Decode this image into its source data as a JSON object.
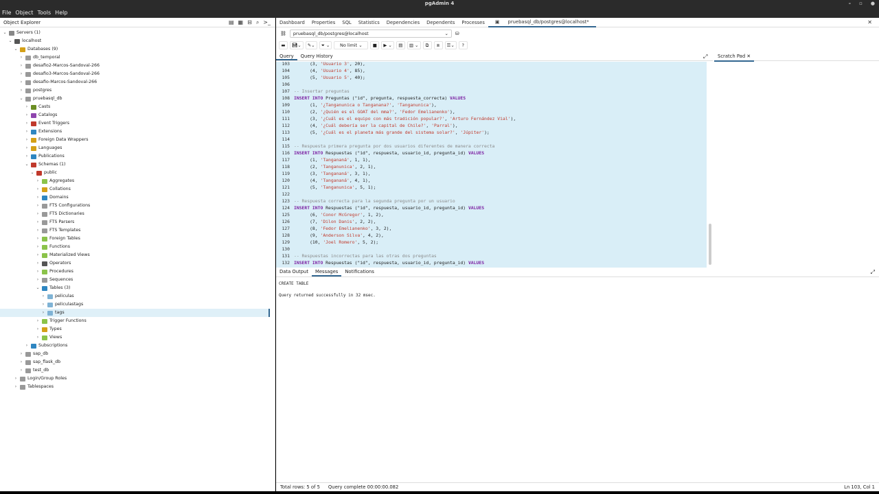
{
  "window": {
    "title": "pgAdmin 4"
  },
  "menu": [
    "File",
    "Object",
    "Tools",
    "Help"
  ],
  "explorer": {
    "title": "Object Explorer",
    "nodes": [
      {
        "label": "Servers (1)",
        "depth": 0,
        "chev": "v",
        "icon": "#888"
      },
      {
        "label": "localhost",
        "depth": 1,
        "chev": "v",
        "icon": "#555"
      },
      {
        "label": "Databases (9)",
        "depth": 2,
        "chev": "v",
        "icon": "#d4a017"
      },
      {
        "label": "db_temporal",
        "depth": 3,
        "chev": ">",
        "icon": "#999"
      },
      {
        "label": "desafio2-Marcos-Sandoval-266",
        "depth": 3,
        "chev": ">",
        "icon": "#999"
      },
      {
        "label": "desafio3-Marcos-Sandoval-266",
        "depth": 3,
        "chev": ">",
        "icon": "#999"
      },
      {
        "label": "desafio-Marcos-Sandoval-266",
        "depth": 3,
        "chev": ">",
        "icon": "#999"
      },
      {
        "label": "postgres",
        "depth": 3,
        "chev": ">",
        "icon": "#999"
      },
      {
        "label": "pruebasql_db",
        "depth": 3,
        "chev": "v",
        "icon": "#999"
      },
      {
        "label": "Casts",
        "depth": 4,
        "chev": ">",
        "icon": "#6b8e23"
      },
      {
        "label": "Catalogs",
        "depth": 4,
        "chev": ">",
        "icon": "#8e44ad"
      },
      {
        "label": "Event Triggers",
        "depth": 4,
        "chev": ">",
        "icon": "#c0392b"
      },
      {
        "label": "Extensions",
        "depth": 4,
        "chev": ">",
        "icon": "#2e86c1"
      },
      {
        "label": "Foreign Data Wrappers",
        "depth": 4,
        "chev": ">",
        "icon": "#d4a017"
      },
      {
        "label": "Languages",
        "depth": 4,
        "chev": ">",
        "icon": "#d4a017"
      },
      {
        "label": "Publications",
        "depth": 4,
        "chev": ">",
        "icon": "#2e86c1"
      },
      {
        "label": "Schemas (1)",
        "depth": 4,
        "chev": "v",
        "icon": "#c0392b"
      },
      {
        "label": "public",
        "depth": 5,
        "chev": "v",
        "icon": "#c0392b"
      },
      {
        "label": "Aggregates",
        "depth": 6,
        "chev": ">",
        "icon": "#8bc34a"
      },
      {
        "label": "Collations",
        "depth": 6,
        "chev": ">",
        "icon": "#d4a017"
      },
      {
        "label": "Domains",
        "depth": 6,
        "chev": ">",
        "icon": "#2e86c1"
      },
      {
        "label": "FTS Configurations",
        "depth": 6,
        "chev": ">",
        "icon": "#999"
      },
      {
        "label": "FTS Dictionaries",
        "depth": 6,
        "chev": ">",
        "icon": "#999"
      },
      {
        "label": "FTS Parsers",
        "depth": 6,
        "chev": ">",
        "icon": "#999"
      },
      {
        "label": "FTS Templates",
        "depth": 6,
        "chev": ">",
        "icon": "#999"
      },
      {
        "label": "Foreign Tables",
        "depth": 6,
        "chev": ">",
        "icon": "#8bc34a"
      },
      {
        "label": "Functions",
        "depth": 6,
        "chev": ">",
        "icon": "#8bc34a"
      },
      {
        "label": "Materialized Views",
        "depth": 6,
        "chev": ">",
        "icon": "#8bc34a"
      },
      {
        "label": "Operators",
        "depth": 6,
        "chev": ">",
        "icon": "#555"
      },
      {
        "label": "Procedures",
        "depth": 6,
        "chev": ">",
        "icon": "#8bc34a"
      },
      {
        "label": "Sequences",
        "depth": 6,
        "chev": ">",
        "icon": "#999"
      },
      {
        "label": "Tables (3)",
        "depth": 6,
        "chev": "v",
        "icon": "#2e86c1"
      },
      {
        "label": "peliculas",
        "depth": 7,
        "chev": ">",
        "icon": "#7fb3d5"
      },
      {
        "label": "peliculastags",
        "depth": 7,
        "chev": ">",
        "icon": "#7fb3d5"
      },
      {
        "label": "tags",
        "depth": 7,
        "chev": ">",
        "icon": "#7fb3d5"
      },
      {
        "label": "Trigger Functions",
        "depth": 6,
        "chev": ">",
        "icon": "#8bc34a"
      },
      {
        "label": "Types",
        "depth": 6,
        "chev": ">",
        "icon": "#d4a017"
      },
      {
        "label": "Views",
        "depth": 6,
        "chev": ">",
        "icon": "#8bc34a"
      },
      {
        "label": "Subscriptions",
        "depth": 4,
        "chev": ">",
        "icon": "#2e86c1"
      },
      {
        "label": "sap_db",
        "depth": 3,
        "chev": ">",
        "icon": "#999"
      },
      {
        "label": "sap_flask_db",
        "depth": 3,
        "chev": ">",
        "icon": "#999"
      },
      {
        "label": "test_db",
        "depth": 3,
        "chev": ">",
        "icon": "#999"
      },
      {
        "label": "Login/Group Roles",
        "depth": 2,
        "chev": ">",
        "icon": "#999"
      },
      {
        "label": "Tablespaces",
        "depth": 2,
        "chev": ">",
        "icon": "#999"
      }
    ]
  },
  "tabs": [
    "Dashboard",
    "Properties",
    "SQL",
    "Statistics",
    "Dependencies",
    "Dependents",
    "Processes"
  ],
  "active_tab": "pruebasql_db/postgres@localhost*",
  "connection": "pruebasql_db/postgres@localhost",
  "toolbar": {
    "limit": "No limit"
  },
  "query_tabs": [
    "Query",
    "Query History"
  ],
  "scratch_pad": "Scratch Pad",
  "editor_lines": [
    {
      "n": "103",
      "segs": [
        [
          "      (3, ",
          ""
        ],
        [
          "'Usuario 3'",
          "str"
        ],
        [
          ", 20),",
          ""
        ]
      ]
    },
    {
      "n": "104",
      "segs": [
        [
          "      (4, ",
          ""
        ],
        [
          "'Usuario 4'",
          "str"
        ],
        [
          ", 85),",
          ""
        ]
      ]
    },
    {
      "n": "105",
      "segs": [
        [
          "      (5, ",
          ""
        ],
        [
          "'Usuario 5'",
          "str"
        ],
        [
          ", 40);",
          ""
        ]
      ]
    },
    {
      "n": "106",
      "segs": [
        [
          "",
          ""
        ]
      ]
    },
    {
      "n": "107",
      "segs": [
        [
          "-- Insertar preguntas",
          "cm"
        ]
      ]
    },
    {
      "n": "108",
      "segs": [
        [
          "INSERT INTO",
          "kw"
        ],
        [
          " Preguntas (\"id\", pregunta, respuesta_correcta) ",
          ""
        ],
        [
          "VALUES",
          "kw"
        ]
      ]
    },
    {
      "n": "109",
      "segs": [
        [
          "      (1, ",
          ""
        ],
        [
          "'¿Tanganunica o Tanganana?'",
          "str"
        ],
        [
          ", ",
          ""
        ],
        [
          "'Tanganunica'",
          "str"
        ],
        [
          "),",
          ""
        ]
      ]
    },
    {
      "n": "110",
      "segs": [
        [
          "      (2, ",
          ""
        ],
        [
          "'¿Quién es el GOAT del mma?'",
          "str"
        ],
        [
          ", ",
          ""
        ],
        [
          "'Fedor Emelianenko'",
          "str"
        ],
        [
          "),",
          ""
        ]
      ]
    },
    {
      "n": "111",
      "segs": [
        [
          "      (3, ",
          ""
        ],
        [
          "'¿Cuál es el equipo con más tradición popular?'",
          "str"
        ],
        [
          ", ",
          ""
        ],
        [
          "'Arturo Fernández Vial'",
          "str"
        ],
        [
          "),",
          ""
        ]
      ]
    },
    {
      "n": "112",
      "segs": [
        [
          "      (4, ",
          ""
        ],
        [
          "'¿Cuál debería ser la capital de Chile?'",
          "str"
        ],
        [
          ", ",
          ""
        ],
        [
          "'Parral'",
          "str"
        ],
        [
          "),",
          ""
        ]
      ]
    },
    {
      "n": "113",
      "segs": [
        [
          "      (5, ",
          ""
        ],
        [
          "'¿Cuál es el planeta más grande del sistema solar?'",
          "str"
        ],
        [
          ", ",
          ""
        ],
        [
          "'Júpiter'",
          "str"
        ],
        [
          ");",
          ""
        ]
      ]
    },
    {
      "n": "114",
      "segs": [
        [
          "",
          ""
        ]
      ]
    },
    {
      "n": "115",
      "segs": [
        [
          "-- Respuesta primera pregunta por dos usuarios diferentes de manera correcta",
          "cm"
        ]
      ]
    },
    {
      "n": "116",
      "segs": [
        [
          "INSERT INTO",
          "kw"
        ],
        [
          " Respuestas (\"id\", respuesta, usuario_id, pregunta_id) ",
          ""
        ],
        [
          "VALUES",
          "kw"
        ]
      ]
    },
    {
      "n": "117",
      "segs": [
        [
          "      (1, ",
          ""
        ],
        [
          "'Tangananá'",
          "str"
        ],
        [
          ", 1, 1),",
          ""
        ]
      ]
    },
    {
      "n": "118",
      "segs": [
        [
          "      (2, ",
          ""
        ],
        [
          "'Tanganunica'",
          "str"
        ],
        [
          ", 2, 1),",
          ""
        ]
      ]
    },
    {
      "n": "119",
      "segs": [
        [
          "      (3, ",
          ""
        ],
        [
          "'Tangananá'",
          "str"
        ],
        [
          ", 3, 1),",
          ""
        ]
      ]
    },
    {
      "n": "120",
      "segs": [
        [
          "      (4, ",
          ""
        ],
        [
          "'Tangananá'",
          "str"
        ],
        [
          ", 4, 1),",
          ""
        ]
      ]
    },
    {
      "n": "121",
      "segs": [
        [
          "      (5, ",
          ""
        ],
        [
          "'Tanganunica'",
          "str"
        ],
        [
          ", 5, 1);",
          ""
        ]
      ]
    },
    {
      "n": "122",
      "segs": [
        [
          "",
          ""
        ]
      ]
    },
    {
      "n": "123",
      "segs": [
        [
          "-- Respuesta correcta para la segunda pregunta por un usuario",
          "cm"
        ]
      ]
    },
    {
      "n": "124",
      "segs": [
        [
          "INSERT INTO",
          "kw"
        ],
        [
          " Respuestas (\"id\", respuesta, usuario_id, pregunta_id) ",
          ""
        ],
        [
          "VALUES",
          "kw"
        ]
      ]
    },
    {
      "n": "125",
      "segs": [
        [
          "      (6, ",
          ""
        ],
        [
          "'Conor McGregor'",
          "str"
        ],
        [
          ", 1, 2),",
          ""
        ]
      ]
    },
    {
      "n": "126",
      "segs": [
        [
          "      (7, ",
          ""
        ],
        [
          "'Dilon Danis'",
          "str"
        ],
        [
          ", 2, 2),",
          ""
        ]
      ]
    },
    {
      "n": "127",
      "segs": [
        [
          "      (8, ",
          ""
        ],
        [
          "'Fedor Emelianenko'",
          "str"
        ],
        [
          ", 3, 2),",
          ""
        ]
      ]
    },
    {
      "n": "128",
      "segs": [
        [
          "      (9, ",
          ""
        ],
        [
          "'Anderson Silva'",
          "str"
        ],
        [
          ", 4, 2),",
          ""
        ]
      ]
    },
    {
      "n": "129",
      "segs": [
        [
          "      (10, ",
          ""
        ],
        [
          "'Joel Romero'",
          "str"
        ],
        [
          ", 5, 2);",
          ""
        ]
      ]
    },
    {
      "n": "130",
      "segs": [
        [
          "",
          ""
        ]
      ]
    },
    {
      "n": "131",
      "segs": [
        [
          "-- Respuestas incorrectas para las otras dos preguntas",
          "cm"
        ]
      ]
    },
    {
      "n": "132",
      "segs": [
        [
          "INSERT INTO",
          "kw"
        ],
        [
          " Respuestas (\"id\", respuesta, usuario_id, pregunta_id) ",
          ""
        ],
        [
          "VALUES",
          "kw"
        ]
      ]
    }
  ],
  "result_tabs": [
    "Data Output",
    "Messages",
    "Notifications"
  ],
  "messages": [
    "CREATE TABLE",
    "Query returned successfully in 32 msec."
  ],
  "status": {
    "rows": "Total rows: 5 of 5",
    "query": "Query complete 00:00:00.082",
    "position": "Ln 103, Col 1"
  }
}
